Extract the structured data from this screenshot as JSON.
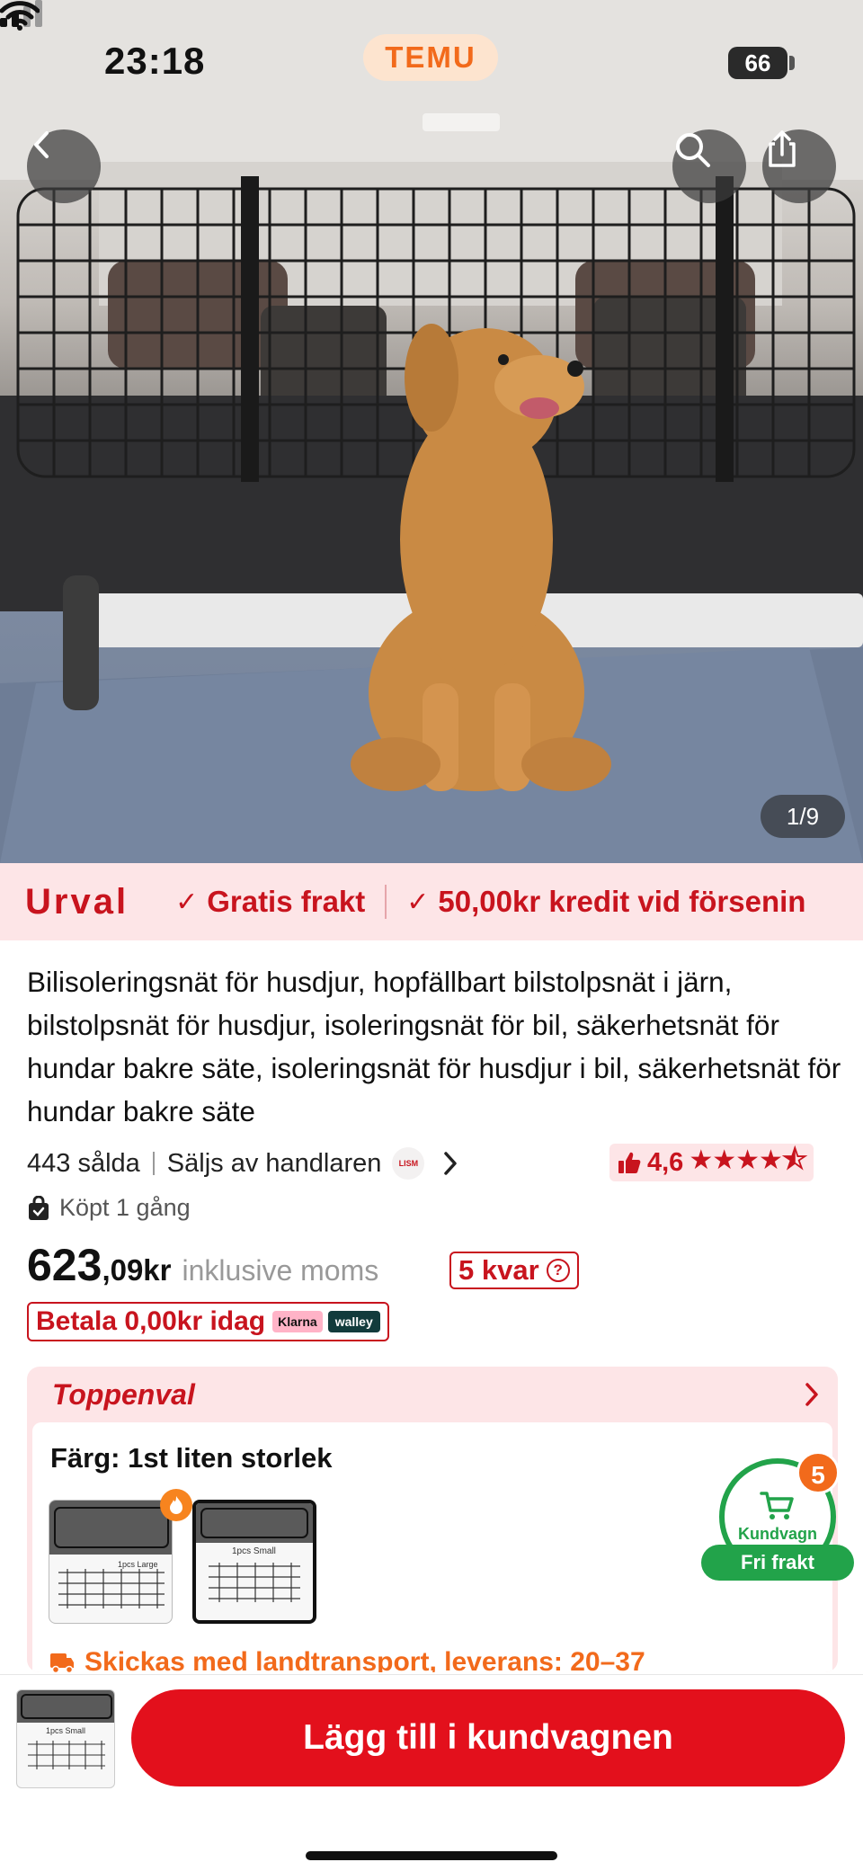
{
  "status_bar": {
    "time": "23:18",
    "battery": "66"
  },
  "app_label": "TEMU",
  "gallery": {
    "counter": "1/9"
  },
  "benefits": {
    "brand": "Urval",
    "items": [
      "Gratis frakt",
      "50,00kr kredit vid försenin"
    ]
  },
  "product": {
    "title": "Bilisoleringsnät för husdjur, hopfällbart bilstolpsnät i järn, bilstolpsnät för husdjur, isoleringsnät för bil, säkerhetsnät för hundar bakre säte, isoleringsnät för husdjur i bil, säkerhetsnät för hundar bakre säte",
    "sold": "443 sålda",
    "seller": "Säljs av handlaren",
    "seller_logo_text": "LISM",
    "rating": "4,6",
    "bought": "Köpt 1 gång",
    "price_main": "623",
    "price_frac": ",09kr",
    "price_note": "inklusive moms",
    "stock": "5 kvar",
    "pay_later": "Betala 0,00kr idag",
    "klarna": "Klarna",
    "walley": "walley"
  },
  "options": {
    "header": "Toppenval",
    "color_label": "Färg: 1st liten storlek",
    "swatches": [
      {
        "label": "1pcs Large",
        "selected": false
      },
      {
        "label": "1pcs Small",
        "selected": true
      }
    ],
    "shipping": "Skickas med landtransport, leverans: 20–37"
  },
  "floating_cart": {
    "count": "5",
    "label": "Kundvagn",
    "free_shipping": "Fri frakt"
  },
  "bottom": {
    "thumb_label": "1pcs Small",
    "add_to_cart": "Lägg till i kundvagnen"
  },
  "colors": {
    "accent_red": "#c8141e",
    "button_red": "#e3101c",
    "orange": "#f26a1b",
    "green": "#22a34a"
  }
}
